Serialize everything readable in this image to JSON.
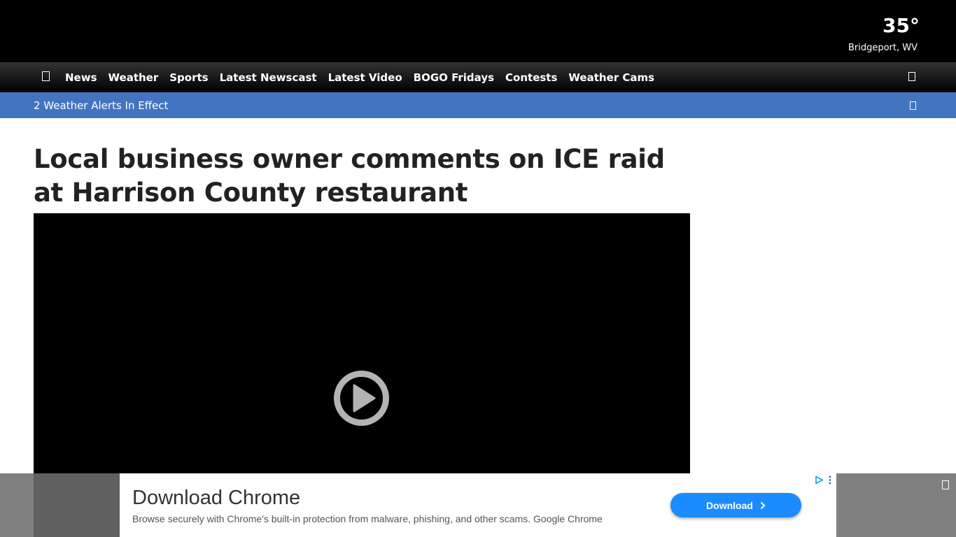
{
  "weather": {
    "temperature": "35°",
    "location": "Bridgeport, WV"
  },
  "nav": {
    "home_icon": "home-icon",
    "items": [
      {
        "label": "News"
      },
      {
        "label": "Weather"
      },
      {
        "label": "Sports"
      },
      {
        "label": "Latest Newscast"
      },
      {
        "label": "Latest Video"
      },
      {
        "label": "BOGO Fridays"
      },
      {
        "label": "Contests"
      },
      {
        "label": "Weather Cams"
      }
    ],
    "search_icon": "search-icon"
  },
  "alerts": {
    "text": "2 Weather Alerts In Effect",
    "icon": "chevron-down-icon"
  },
  "article": {
    "headline": "Local business owner comments on ICE raid at Harrison County restaurant"
  },
  "video": {
    "play_icon": "play-icon"
  },
  "ad": {
    "title": "Download Chrome",
    "description": "Browse securely with Chrome's built-in protection from malware, phishing, and other scams. Google Chrome",
    "button_label": "Download",
    "choices_icon": "adchoices-icon",
    "menu_icon": "more-vertical-icon",
    "close_icon": "close-icon"
  },
  "colors": {
    "alerts_bar": "#4374c0",
    "ad_button": "#1a8cff",
    "headline_text": "#222222"
  }
}
